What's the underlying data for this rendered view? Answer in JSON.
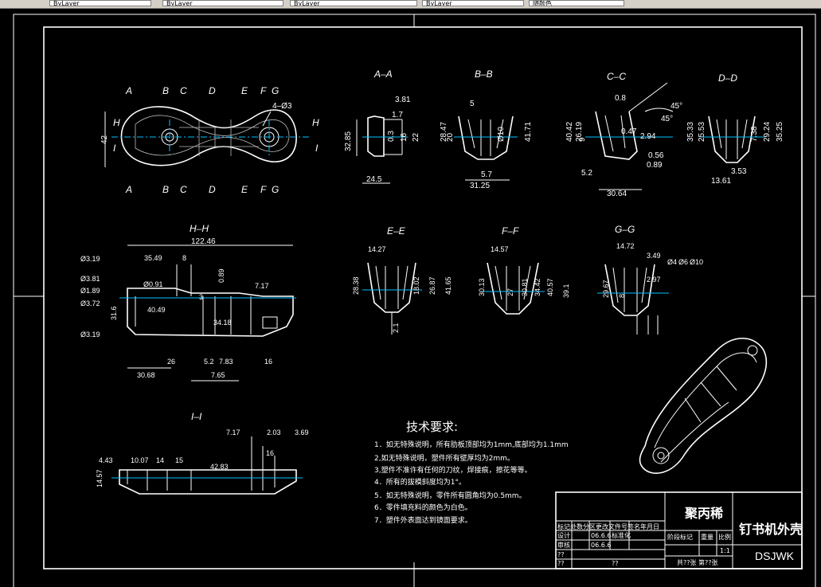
{
  "toolbar": {
    "combos": [
      "ByLayer",
      "ByLayer",
      "ByLayer",
      "ByLayer",
      "随颜色"
    ]
  },
  "drawing": {
    "views": {
      "aa": "A–A",
      "bb": "B–B",
      "cc": "C–C",
      "dd": "D–D",
      "hh": "H–H",
      "ee": "E–E",
      "ff": "F–F",
      "gg": "G–G",
      "ii": "I–I"
    },
    "top_view": {
      "cut_labels_top": [
        "A",
        "B",
        "C",
        "D",
        "E",
        "F",
        "G"
      ],
      "cut_labels_bottom": [
        "A",
        "B",
        "C",
        "D",
        "E",
        "F",
        "G"
      ],
      "side_labels": [
        "H",
        "H",
        "I",
        "I"
      ],
      "dims": [
        "42",
        "4–Ø3"
      ]
    },
    "aa_dims": [
      "3.81",
      "1.7",
      "32.85",
      "0.3",
      "16",
      "22",
      "24.5"
    ],
    "bb_dims": [
      "5",
      "28.47",
      "20",
      "Ø10",
      "41.71",
      "5.7",
      "31.25"
    ],
    "cc_dims": [
      "0.8",
      "45°",
      "45°",
      "40.42",
      "26.19",
      "9",
      "0.47",
      "2.94",
      "0.56",
      "0.89",
      "5.2",
      "30.64"
    ],
    "dd_dims": [
      "35.33",
      "25.53",
      "7.38",
      "29.24",
      "35.25",
      "3.53",
      "13.61"
    ],
    "hh_dims": [
      "122.46",
      "Ø3.19",
      "35.49",
      "8",
      "Ø3.81",
      "Ø1.89",
      "Ø3.72",
      "Ø0.91",
      "0.89",
      "7.17",
      "40.49",
      "3",
      "31.6",
      "34.18",
      "Ø3.19",
      "26",
      "5.2",
      "7.83",
      "16",
      "30.68",
      "7.65"
    ],
    "ee_dims": [
      "14.27",
      "28.38",
      "18.02",
      "26.87",
      "41.65",
      "2.1"
    ],
    "ff_dims": [
      "14.57",
      "30.13",
      "27",
      "30.81",
      "34.42",
      "40.57"
    ],
    "gg_dims": [
      "14.72",
      "3.49",
      "Ø4",
      "Ø6",
      "Ø10",
      "2.97",
      "39.1",
      "29.67",
      "8"
    ],
    "ii_dims": [
      "7.17",
      "2.03",
      "3.69",
      "16",
      "4.43",
      "10.07",
      "14",
      "15",
      "42.83",
      "14.57"
    ]
  },
  "requirements": {
    "heading": "技术要求:",
    "items": [
      "1．如无特殊说明，所有肋板顶部均为1mm,底部均为1.1mm",
      "2,如无特殊说明，塑件所有壁厚均为2mm。",
      "3,塑件不准许有任何的刀纹，焊接痕，擦花等等。",
      "4．所有的拔模斜度均为1°。",
      "5．如无特殊说明，零件所有圆角均为0.5mm。",
      "6．零件填充料的颜色为白色。",
      "7．塑件外表面达到镜面要求。"
    ]
  },
  "title_block": {
    "material": "聚丙稀",
    "part_name": "钉书机外壳",
    "drawing_code": "DSJWK",
    "revision_header": "标记处数分区更改文件号签名年月日",
    "designer_row": [
      "设计",
      "06.6.6",
      "标准化"
    ],
    "approve_row": [
      "审核",
      "06.6.6"
    ],
    "stage_header": [
      "阶段标记",
      "重量",
      "比例"
    ],
    "scale": "1:1",
    "process": "??",
    "approved": "??",
    "sheet_info": "共??张 第??张",
    "unknown_row": "??"
  }
}
